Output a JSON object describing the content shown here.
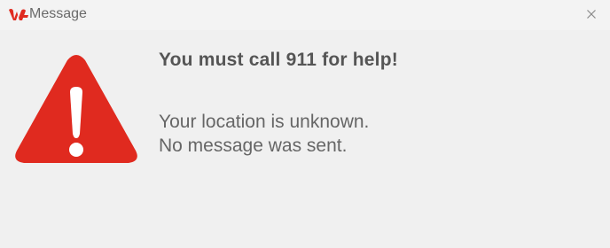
{
  "window": {
    "title": "Message",
    "app_icon": "app-logo-icon",
    "close_icon": "close-icon"
  },
  "dialog": {
    "icon": "warning-icon",
    "headline": "You must call 911 for help!",
    "lines": [
      "Your location is unknown.",
      "No message was sent."
    ]
  },
  "colors": {
    "warning_red": "#e02a1f",
    "background": "#f0f0f0",
    "headline_text": "#555555",
    "body_text": "#666666"
  }
}
